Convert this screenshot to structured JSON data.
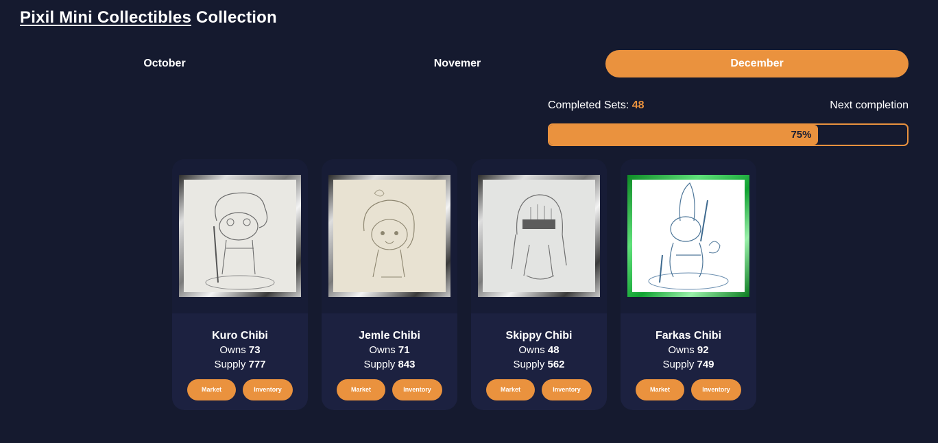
{
  "header": {
    "collection_link": "Pixil Mini Collectibles",
    "suffix": "Collection"
  },
  "tabs": [
    {
      "label": "October",
      "active": false
    },
    {
      "label": "Novemer",
      "active": false
    },
    {
      "label": "December",
      "active": true
    }
  ],
  "progress": {
    "completed_label": "Completed Sets:",
    "completed_value": "48",
    "next_label": "Next completion",
    "percent_label": "75%",
    "percent": 75
  },
  "colors": {
    "accent": "#ea923e",
    "background": "#151a2f",
    "card": "#1c2140"
  },
  "cards": [
    {
      "name": "Kuro Chibi",
      "owns_label": "Owns",
      "owns": "73",
      "supply_label": "Supply",
      "supply": "777",
      "frame": "silver",
      "market": "Market",
      "inventory": "Inventory"
    },
    {
      "name": "Jemle Chibi",
      "owns_label": "Owns",
      "owns": "71",
      "supply_label": "Supply",
      "supply": "843",
      "frame": "silver",
      "market": "Market",
      "inventory": "Inventory"
    },
    {
      "name": "Skippy Chibi",
      "owns_label": "Owns",
      "owns": "48",
      "supply_label": "Supply",
      "supply": "562",
      "frame": "silver",
      "market": "Market",
      "inventory": "Inventory"
    },
    {
      "name": "Farkas Chibi",
      "owns_label": "Owns",
      "owns": "92",
      "supply_label": "Supply",
      "supply": "749",
      "frame": "green",
      "market": "Market",
      "inventory": "Inventory"
    }
  ]
}
